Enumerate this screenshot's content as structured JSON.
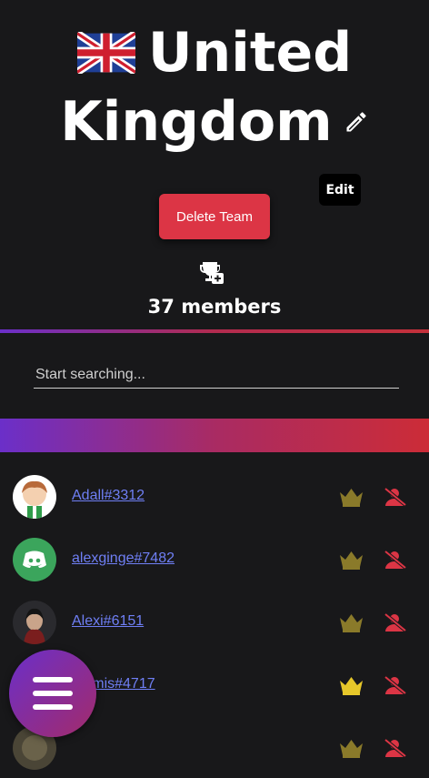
{
  "team": {
    "name_line1": "United",
    "name_line2": "Kingdom",
    "flag_icon": "uk-flag-icon",
    "edit_tooltip": "Edit",
    "delete_label": "Delete Team",
    "members_label": "37 members"
  },
  "search": {
    "placeholder": "Start searching..."
  },
  "colors": {
    "background": "#18181a",
    "accent_purple": "#6b2fc9",
    "accent_red": "#dc3545",
    "link": "#6f7ff5",
    "crown_dim": "#8a7a2a",
    "crown_active": "#e6c72a"
  },
  "members": [
    {
      "name": "Adall#3312"
    },
    {
      "name": "alexginge#7482"
    },
    {
      "name": "Alexi#6151"
    },
    {
      "name": "...emis#4717"
    },
    {
      "name": ""
    }
  ],
  "icons": {
    "edit": "pencil-icon",
    "trophy": "trophy-add-icon",
    "crown": "crown-icon",
    "remove": "remove-member-icon",
    "menu": "menu-icon"
  }
}
